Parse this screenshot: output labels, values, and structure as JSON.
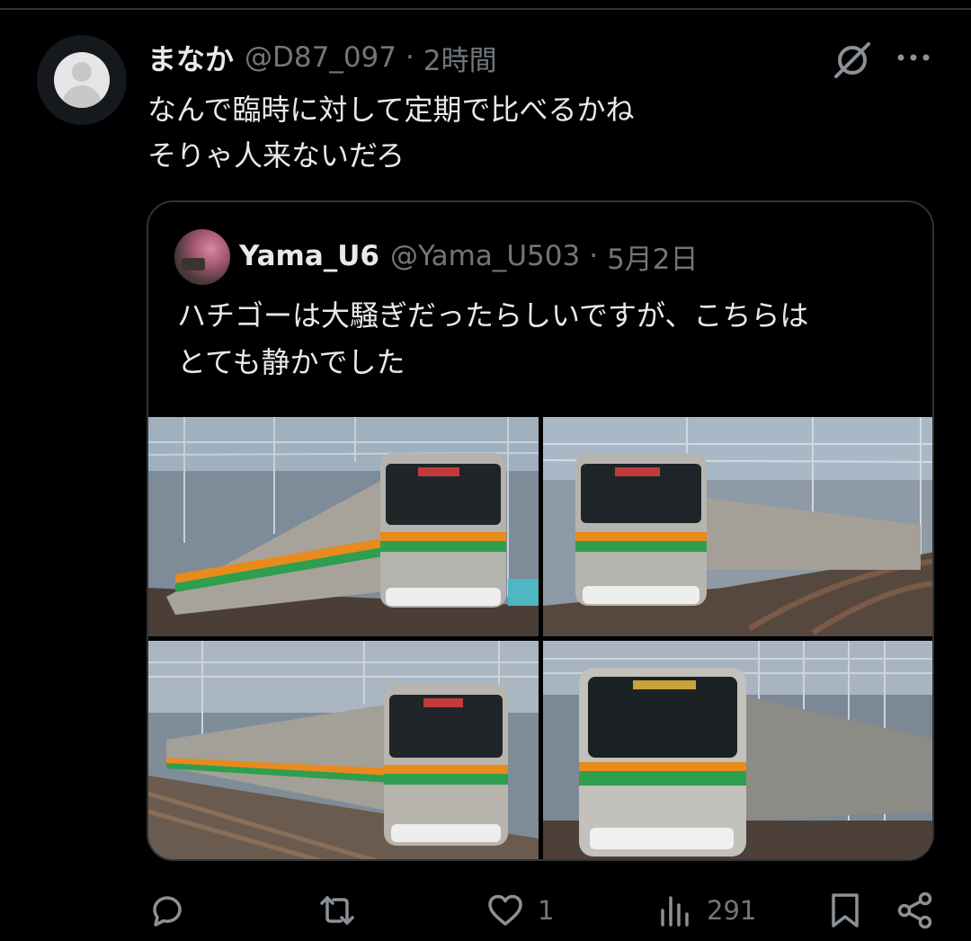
{
  "post": {
    "display_name": "まなか",
    "handle": "@D87_097",
    "separator": "·",
    "time": "2時間",
    "text_line1": "なんで臨時に対して定期で比べるかね",
    "text_line2": "そりゃ人来ないだろ"
  },
  "quoted": {
    "display_name": "Yama_U6",
    "handle": "@Yama_U503",
    "separator": "·",
    "time": "5月2日",
    "text_line1": "ハチゴーは大騒ぎだったらしいですが、こちらは",
    "text_line2": "とても静かでした",
    "media_count": 4
  },
  "actions": {
    "reply_count": "",
    "repost_count": "",
    "like_count": "1",
    "view_count": "291"
  },
  "icons": [
    "reply-icon",
    "repost-icon",
    "like-icon",
    "views-icon",
    "bookmark-icon",
    "share-icon",
    "grok-icon",
    "more-icon"
  ],
  "colors": {
    "background": "#000000",
    "text_primary": "#e7e9ea",
    "text_secondary": "#71767b",
    "border": "#2f3336",
    "train_orange": "#e88a1c",
    "train_green": "#2e9e4f"
  }
}
